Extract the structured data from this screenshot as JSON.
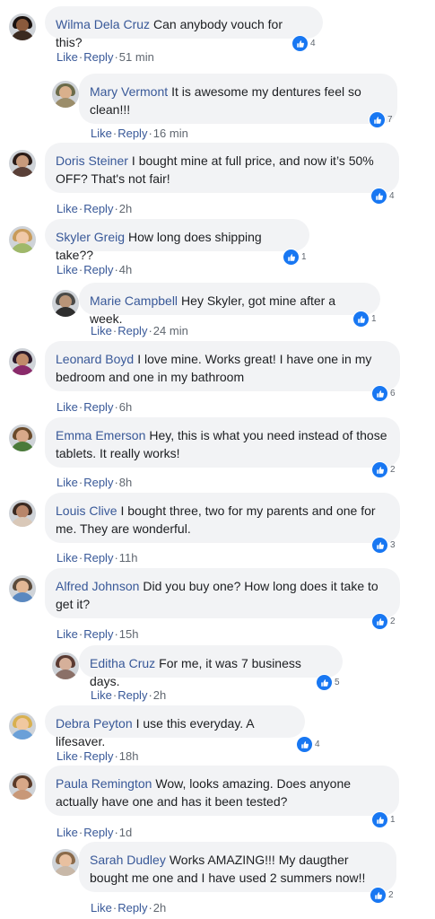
{
  "comments": [
    {
      "author": "Wilma Dela Cruz",
      "text": "Can anybody vouch for this?",
      "likes": "4",
      "like": "Like",
      "reply": "Reply",
      "time": "51 min",
      "avatar": {
        "skin": "#8a5a3c",
        "hair": "#1a1210",
        "shirt": "#3b2a20"
      }
    },
    {
      "author": "Mary Vermont",
      "text": "It is awesome my dentures feel so clean!!!",
      "likes": "7",
      "like": "Like",
      "reply": "Reply",
      "time": "16 min",
      "avatar": {
        "skin": "#d9b08c",
        "hair": "#6b6b4a",
        "shirt": "#9b8d6a"
      }
    },
    {
      "author": "Doris Steiner",
      "text": "I bought mine at full price, and now it’s 50% OFF? That's not fair!",
      "likes": "4",
      "like": "Like",
      "reply": "Reply",
      "time": "2h",
      "avatar": {
        "skin": "#c79a7c",
        "hair": "#2a1c18",
        "shirt": "#5a4038"
      }
    },
    {
      "author": "Skyler Greig",
      "text": "How long does shipping take??",
      "likes": "1",
      "like": "Like",
      "reply": "Reply",
      "time": "4h",
      "avatar": {
        "skin": "#f0c9a8",
        "hair": "#c89b5a",
        "shirt": "#9fb86a"
      }
    },
    {
      "author": "Marie Campbell",
      "text": "Hey Skyler, got mine after a week.",
      "likes": "1",
      "like": "Like",
      "reply": "Reply",
      "time": "24 min",
      "avatar": {
        "skin": "#b89478",
        "hair": "#4a4a48",
        "shirt": "#2e2e2e"
      }
    },
    {
      "author": "Leonard Boyd",
      "text": "I love mine. Works great! I have one in my bedroom and one in my bathroom",
      "likes": "6",
      "like": "Like",
      "reply": "Reply",
      "time": "6h",
      "avatar": {
        "skin": "#c08a6a",
        "hair": "#2c1a2a",
        "shirt": "#8a2a6a"
      }
    },
    {
      "author": "Emma Emerson",
      "text": "Hey, this is what you need instead of those tablets. It really works!",
      "likes": "2",
      "like": "Like",
      "reply": "Reply",
      "time": "8h",
      "avatar": {
        "skin": "#d8a98a",
        "hair": "#6a4a2a",
        "shirt": "#4a7a3a"
      }
    },
    {
      "author": "Louis Clive",
      "text": "I bought three, two for my parents and one for me. They are wonderful.",
      "likes": "3",
      "like": "Like",
      "reply": "Reply",
      "time": "11h",
      "avatar": {
        "skin": "#b8866a",
        "hair": "#3a2a22",
        "shirt": "#d9c8b8"
      }
    },
    {
      "author": "Alfred Johnson",
      "text": "Did you buy one? How long does it take to get it?",
      "likes": "2",
      "like": "Like",
      "reply": "Reply",
      "time": "15h",
      "avatar": {
        "skin": "#e2b896",
        "hair": "#5a4a3a",
        "shirt": "#5a88c0"
      }
    },
    {
      "author": "Editha Cruz",
      "text": "For me, it was 7 business days.",
      "likes": "5",
      "like": "Like",
      "reply": "Reply",
      "time": "2h",
      "avatar": {
        "skin": "#d6b09a",
        "hair": "#5a3a32",
        "shirt": "#8a7068"
      }
    },
    {
      "author": "Debra Peyton",
      "text": "I use this everyday. A lifesaver.",
      "likes": "4",
      "like": "Like",
      "reply": "Reply",
      "time": "18h",
      "avatar": {
        "skin": "#f0c8a0",
        "hair": "#d8b050",
        "shirt": "#6aa0d8"
      }
    },
    {
      "author": "Paula Remington",
      "text": "Wow, looks amazing. Does anyone actually have one and has it been tested?",
      "likes": "1",
      "like": "Like",
      "reply": "Reply",
      "time": "1d",
      "avatar": {
        "skin": "#d8a888",
        "hair": "#5a3a28",
        "shirt": "#c89878"
      }
    },
    {
      "author": "Sarah Dudley",
      "text": "Works AMAZING!!! My daugther bought me one and I have used 2 summers now!!",
      "likes": "2",
      "like": "Like",
      "reply": "Reply",
      "time": "2h",
      "avatar": {
        "skin": "#e8c0a0",
        "hair": "#8a6a4a",
        "shirt": "#c8b8a8"
      }
    }
  ]
}
